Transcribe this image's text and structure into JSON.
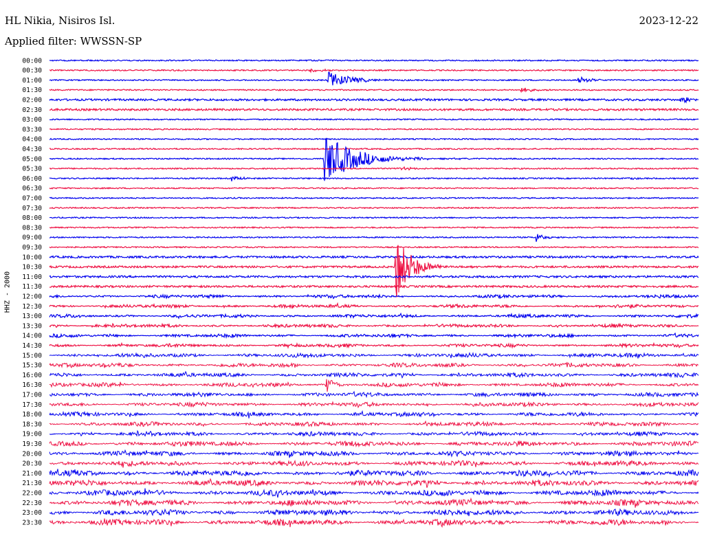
{
  "header": {
    "station": "HL Nikia, Nisiros Isl.",
    "date": "2023-12-22",
    "filter": "Applied filter: WWSSN-SP",
    "channel": "HHZ - 2000"
  },
  "colors": {
    "trace_a": "#0000ee",
    "trace_b": "#ee1144",
    "background": "#ffffff",
    "text": "#000000"
  },
  "chart_data": {
    "type": "line",
    "title": "HL Nikia, Nisiros Isl.",
    "xlabel": "",
    "ylabel": "HHZ - 2000",
    "grid": false,
    "legend": "none",
    "row_interval_minutes": 30,
    "categories": [
      "00:00",
      "00:30",
      "01:00",
      "01:30",
      "02:00",
      "02:30",
      "03:00",
      "03:30",
      "04:00",
      "04:30",
      "05:00",
      "05:30",
      "06:00",
      "06:30",
      "07:00",
      "07:30",
      "08:00",
      "08:30",
      "09:00",
      "09:30",
      "10:00",
      "10:30",
      "11:00",
      "11:30",
      "12:00",
      "12:30",
      "13:00",
      "13:30",
      "14:00",
      "14:30",
      "15:00",
      "15:30",
      "16:00",
      "16:30",
      "17:00",
      "17:30",
      "18:00",
      "18:30",
      "19:00",
      "19:30",
      "20:00",
      "20:30",
      "21:00",
      "21:30",
      "22:00",
      "22:30",
      "23:00",
      "23:30"
    ],
    "noise_level": [
      1,
      1,
      1,
      1,
      2,
      2,
      1,
      1,
      1,
      1,
      1,
      1,
      1,
      1,
      1,
      1,
      1,
      1,
      1,
      1,
      2,
      2,
      2,
      2,
      3,
      3,
      3,
      3,
      3,
      3,
      4,
      4,
      4,
      4,
      4,
      4,
      4,
      4,
      4,
      5,
      5,
      5,
      6,
      6,
      6,
      6,
      6,
      6
    ],
    "events": [
      {
        "row": 1,
        "minute": 12.0,
        "amplitude": 3,
        "duration": 1.0
      },
      {
        "row": 2,
        "minute": 12.9,
        "amplitude": 12,
        "duration": 1.8
      },
      {
        "row": 2,
        "minute": 24.4,
        "amplitude": 6,
        "duration": 1.0
      },
      {
        "row": 3,
        "minute": 21.8,
        "amplitude": 4,
        "duration": 0.8
      },
      {
        "row": 4,
        "minute": 29.2,
        "amplitude": 6,
        "duration": 0.6
      },
      {
        "row": 10,
        "minute": 12.7,
        "amplitude": 36,
        "duration": 2.5
      },
      {
        "row": 11,
        "minute": 16.1,
        "amplitude": 3,
        "duration": 1.0
      },
      {
        "row": 12,
        "minute": 8.4,
        "amplitude": 6,
        "duration": 0.6
      },
      {
        "row": 12,
        "minute": 26.7,
        "amplitude": 3,
        "duration": 0.5
      },
      {
        "row": 18,
        "minute": 22.5,
        "amplitude": 7,
        "duration": 0.6
      },
      {
        "row": 21,
        "minute": 16.0,
        "amplitude": 52,
        "duration": 1.2
      },
      {
        "row": 33,
        "minute": 12.8,
        "amplitude": 16,
        "duration": 0.5
      }
    ]
  }
}
